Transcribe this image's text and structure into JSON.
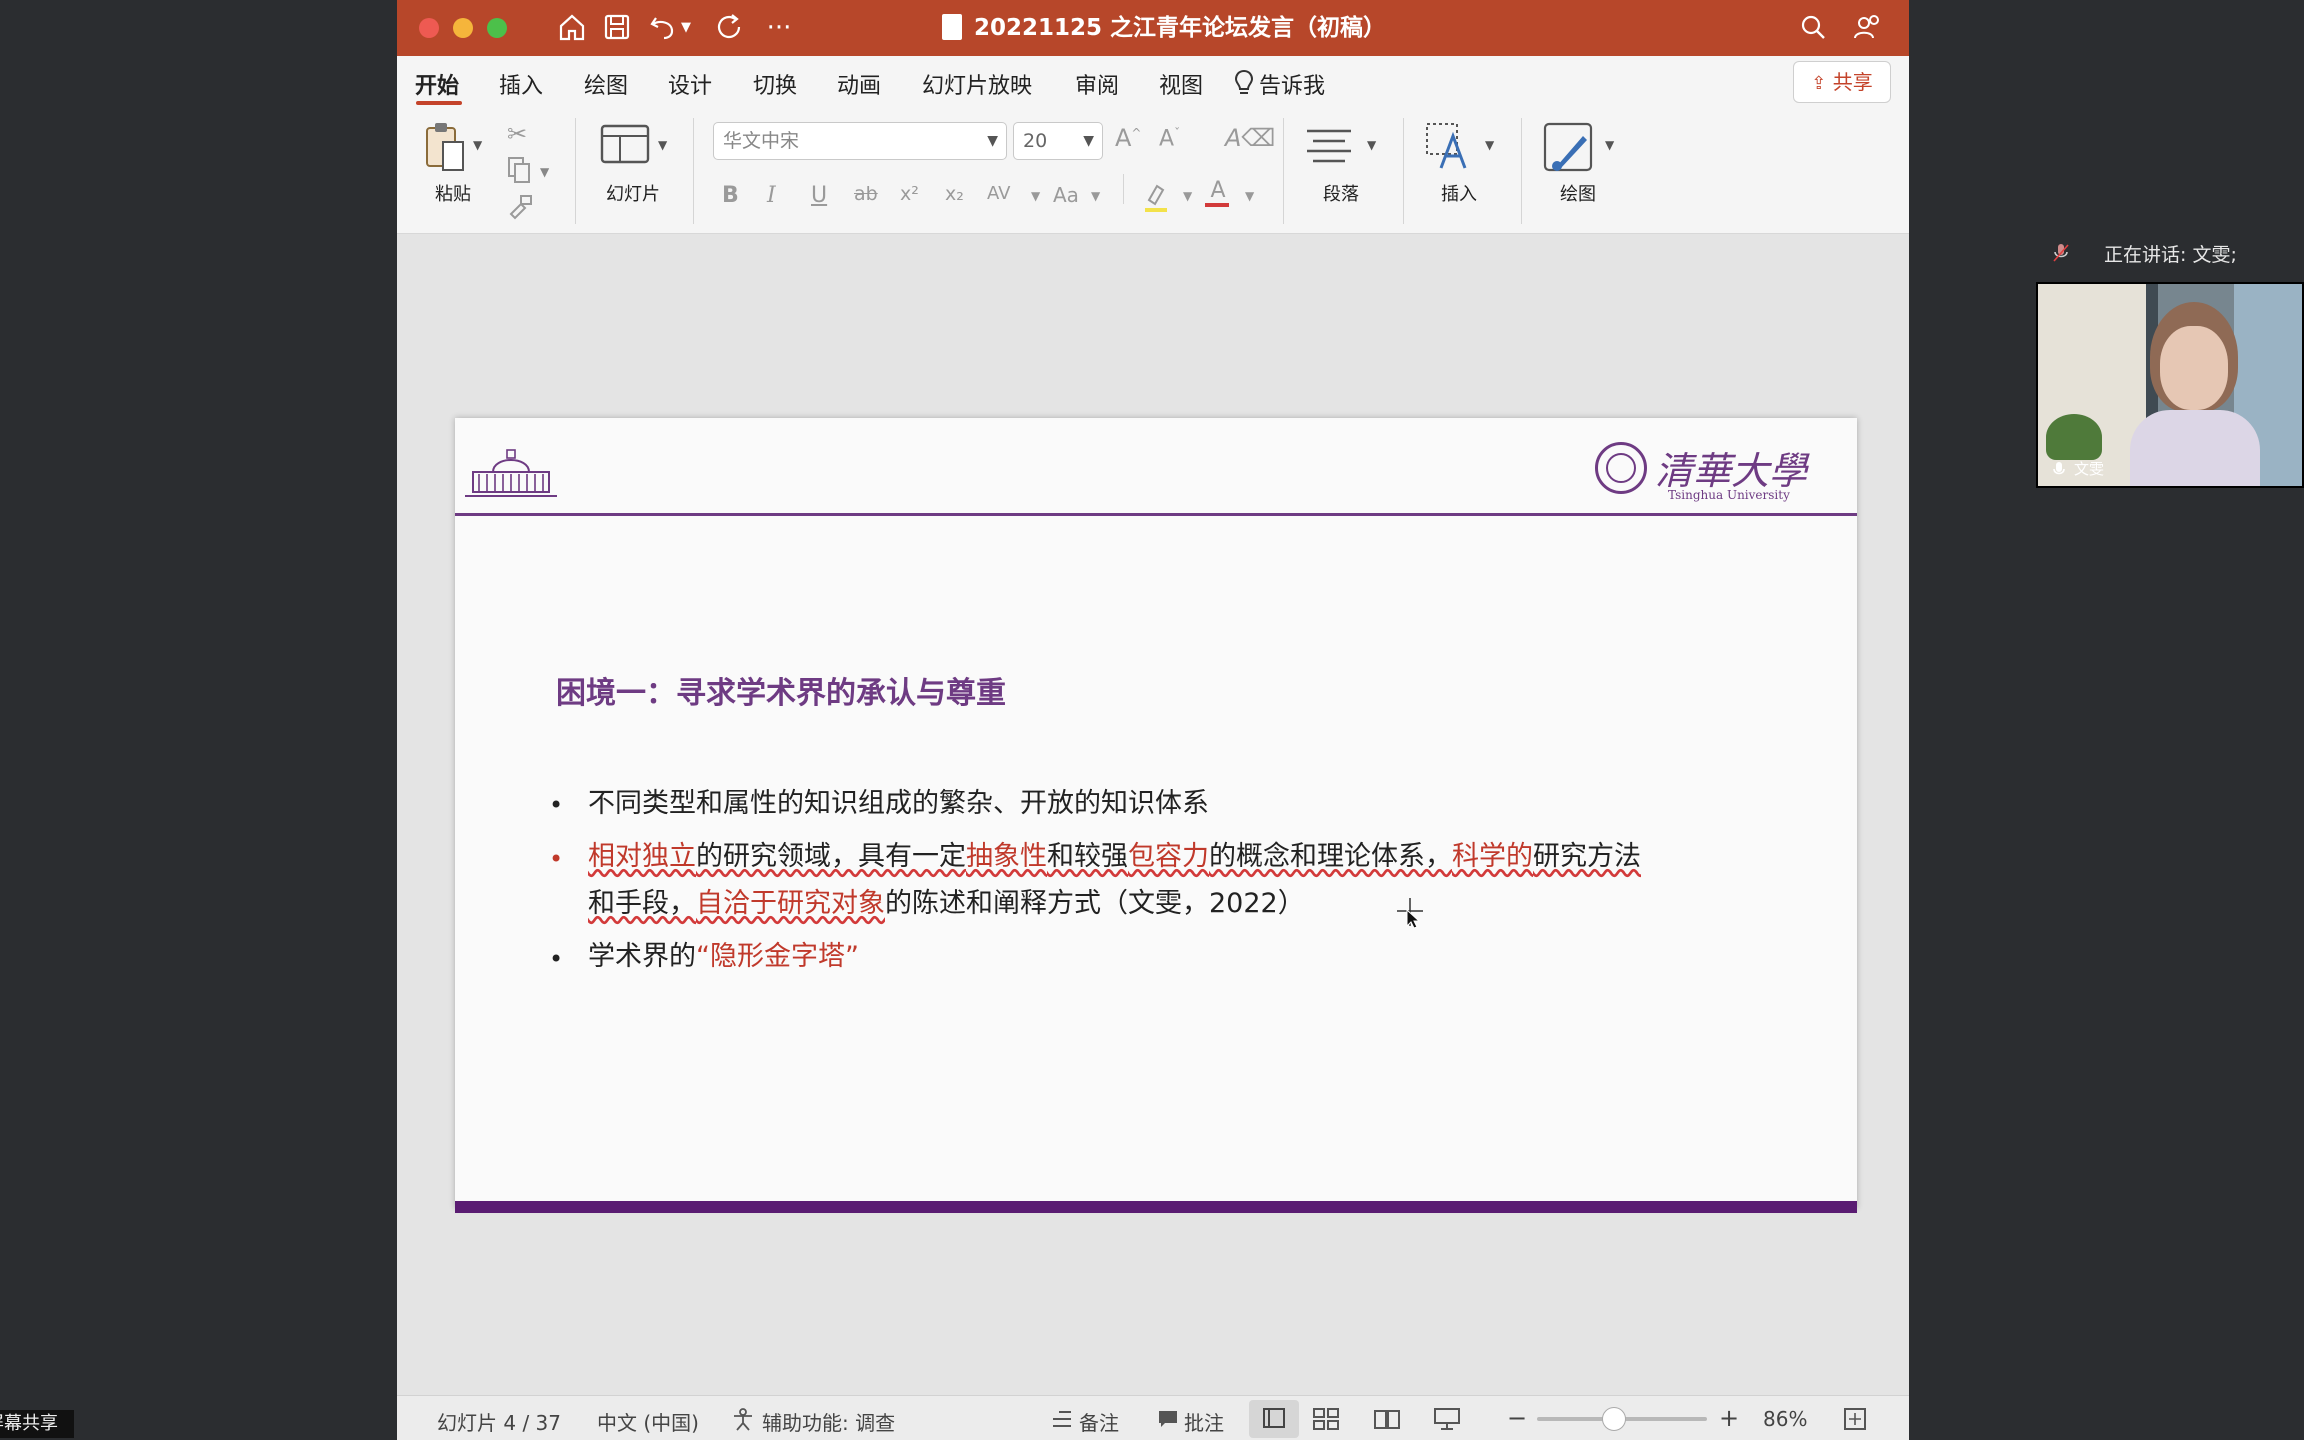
{
  "window": {
    "title": "20221125 之江青年论坛发言（初稿）",
    "share_label": "共享",
    "tabs": [
      "开始",
      "插入",
      "绘图",
      "设计",
      "切换",
      "动画",
      "幻灯片放映",
      "审阅",
      "视图"
    ],
    "tell_me": "告诉我"
  },
  "ribbon": {
    "paste_label": "粘贴",
    "slides_label": "幻灯片",
    "font_name": "华文中宋",
    "font_size": "20",
    "paragraph_label": "段落",
    "insert_label": "插入",
    "draw_label": "绘图",
    "format_buttons": [
      "B",
      "I",
      "U",
      "ab",
      "x²",
      "x₂",
      "AV",
      "Aa"
    ]
  },
  "slide": {
    "university_cn": "清華大學",
    "university_en": "Tsinghua University",
    "heading": "困境一：寻求学术界的承认与尊重",
    "bullet1": "不同类型和属性的知识组成的繁杂、开放的知识体系",
    "bullet2": {
      "p1": "相对独立",
      "p2": "的研究领域，具有一定",
      "p3": "抽象性",
      "p4": "和较强",
      "p5": "包容力",
      "p6": "的概念和理论体系，",
      "p7": "科学的",
      "p8": "研究方法",
      "p9": "和手段，",
      "p10": "自洽于研究对象",
      "p11": "的陈述和阐释方式（文雯，2022）"
    },
    "bullet3": {
      "p1": "学术界的",
      "p2": "“隐形金字塔”"
    }
  },
  "statusbar": {
    "slide_counter": "幻灯片 4 / 37",
    "language": "中文 (中国)",
    "accessibility": "辅助功能: 调查",
    "notes": "备注",
    "comments": "批注",
    "zoom": "86%",
    "zoom_fraction": 0.45
  },
  "meeting": {
    "speaking": "正在讲话: 文雯;",
    "participant": "文雯",
    "screen_share": "屏幕共享"
  },
  "colors": {
    "titlebar": "#b7472a",
    "accent_purple": "#6e3b83",
    "highlight_red": "#c0392b"
  }
}
